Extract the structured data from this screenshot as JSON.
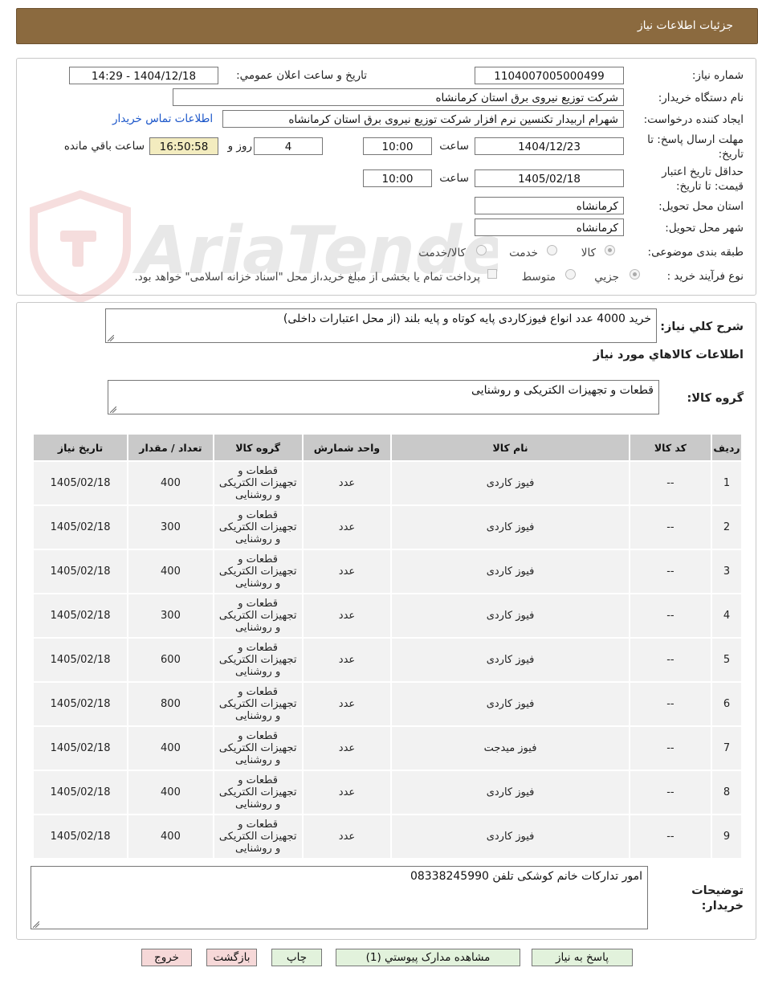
{
  "header": {
    "title": "جزئيات اطلاعات نياز"
  },
  "form": {
    "need_number_label": "شماره نياز:",
    "need_number": "1104007005000499",
    "announce_label": "تاريخ و ساعت اعلان عمومي:",
    "announce_value": "1404/12/18 - 14:29",
    "buyer_org_label": "نام دستگاه خريدار:",
    "buyer_org": "شرکت توزیع نیروی برق استان کرمانشاه",
    "creator_label": "ايجاد کننده درخواست:",
    "creator": "شهرام اربیدار تکنسین نرم افزار شرکت توزیع نیروی برق استان کرمانشاه",
    "contact_link": "اطلاعات تماس خريدار",
    "deadline_label": "مهلت ارسال پاسخ: تا تاريخ:",
    "deadline_date": "1404/12/23",
    "time_label": "ساعت",
    "deadline_time": "10:00",
    "days_value": "4",
    "days_label": "روز و",
    "remaining_time": "16:50:58",
    "remaining_label": "ساعت باقي مانده",
    "validity_label": "حداقل تاريخ اعتبار قيمت: تا تاريخ:",
    "validity_date": "1405/02/18",
    "validity_time": "10:00",
    "province_label": "استان محل تحويل:",
    "province": "کرمانشاه",
    "city_label": "شهر محل تحويل:",
    "city": "کرمانشاه",
    "category_label": "طبقه بندی موضوعی:",
    "category_options": [
      "کالا",
      "خدمت",
      "کالا/خدمت"
    ],
    "process_label": "نوع فرآيند خريد :",
    "process_options": [
      "جزيي",
      "متوسط"
    ],
    "payment_note": "پرداخت تمام يا بخشی از مبلغ خريد،از محل \"اسناد خزانه اسلامی\" خواهد بود."
  },
  "description": {
    "label": "شرح کلي نياز:",
    "text": "خرید  4000 عدد انواع فیوزکاردی پایه کوتاه و پایه بلند (از محل اعتبارات داخلی)"
  },
  "goods": {
    "section_title": "اطلاعات کالاهاي مورد نياز",
    "group_label": "گروه کالا:",
    "group_value": "قطعات و تجهیزات الکتریکی و روشنایی",
    "columns": [
      "رديف",
      "کد کالا",
      "نام کالا",
      "واحد شمارش",
      "گروه کالا",
      "تعداد / مقدار",
      "تاريخ نياز"
    ],
    "rows": [
      {
        "idx": "1",
        "code": "--",
        "name": "فیوز کاردی",
        "unit": "عدد",
        "group": "قطعات و تجهیزات الکتریکی و روشنایی",
        "qty": "400",
        "date": "1405/02/18"
      },
      {
        "idx": "2",
        "code": "--",
        "name": "فیوز کاردی",
        "unit": "عدد",
        "group": "قطعات و تجهیزات الکتریکی و روشنایی",
        "qty": "300",
        "date": "1405/02/18"
      },
      {
        "idx": "3",
        "code": "--",
        "name": "فیوز کاردی",
        "unit": "عدد",
        "group": "قطعات و تجهیزات الکتریکی و روشنایی",
        "qty": "400",
        "date": "1405/02/18"
      },
      {
        "idx": "4",
        "code": "--",
        "name": "فیوز کاردی",
        "unit": "عدد",
        "group": "قطعات و تجهیزات الکتریکی و روشنایی",
        "qty": "300",
        "date": "1405/02/18"
      },
      {
        "idx": "5",
        "code": "--",
        "name": "فیوز کاردی",
        "unit": "عدد",
        "group": "قطعات و تجهیزات الکتریکی و روشنایی",
        "qty": "600",
        "date": "1405/02/18"
      },
      {
        "idx": "6",
        "code": "--",
        "name": "فیوز کاردی",
        "unit": "عدد",
        "group": "قطعات و تجهیزات الکتریکی و روشنایی",
        "qty": "800",
        "date": "1405/02/18"
      },
      {
        "idx": "7",
        "code": "--",
        "name": "فیوز میدجت",
        "unit": "عدد",
        "group": "قطعات و تجهیزات الکتریکی و روشنایی",
        "qty": "400",
        "date": "1405/02/18"
      },
      {
        "idx": "8",
        "code": "--",
        "name": "فیوز کاردی",
        "unit": "عدد",
        "group": "قطعات و تجهیزات الکتریکی و روشنایی",
        "qty": "400",
        "date": "1405/02/18"
      },
      {
        "idx": "9",
        "code": "--",
        "name": "فیوز کاردی",
        "unit": "عدد",
        "group": "قطعات و تجهیزات الکتریکی و روشنایی",
        "qty": "400",
        "date": "1405/02/18"
      }
    ]
  },
  "buyer_notes": {
    "label": "توضيحات خريدار:",
    "text": "امور تدارکات خانم کوشکی تلفن 08338245990"
  },
  "buttons": {
    "reply": "پاسخ به نياز",
    "attachments": "مشاهده مدارک پيوستي (1)",
    "print": "چاپ",
    "back": "بازگشت",
    "exit": "خروج"
  },
  "watermark": {
    "text": "AriaTender.neT"
  }
}
